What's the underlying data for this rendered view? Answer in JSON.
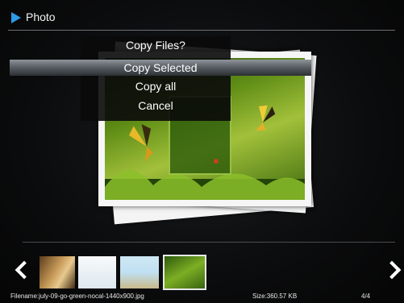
{
  "header": {
    "title": "Photo"
  },
  "dialog": {
    "title": "Copy Files?",
    "options": [
      "Copy Selected",
      "Copy all",
      "Cancel"
    ],
    "selected": "Copy Selected"
  },
  "thumbnails": [
    {
      "name": "lion-thumbnail"
    },
    {
      "name": "white-thumbnail"
    },
    {
      "name": "beach-thumbnail"
    },
    {
      "name": "green-butterfly-thumbnail",
      "selected": true
    }
  ],
  "status": {
    "filename": "Filename:july-09-go-green-nocal-1440x900.jpg",
    "size": "Size:360.57 KB",
    "count": "4/4"
  },
  "colors": {
    "accent": "#2e9be8",
    "selection": "#8f959b",
    "background": "#0b0c0d"
  },
  "icons": [
    "play-icon",
    "left-arrow-icon",
    "right-arrow-icon"
  ]
}
